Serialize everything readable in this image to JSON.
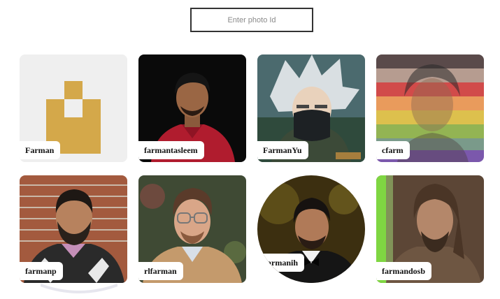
{
  "search": {
    "placeholder": "Enter photo Id",
    "value": ""
  },
  "photos": [
    {
      "username": "Farman",
      "avatar": "identicon-avatar"
    },
    {
      "username": "farmantasleem",
      "avatar": "man-red-shirt-photo"
    },
    {
      "username": "FarmanYu",
      "avatar": "anime-character-avatar"
    },
    {
      "username": "cfarm",
      "avatar": "rainbow-flag-portrait"
    },
    {
      "username": "farmanp",
      "avatar": "bearded-man-brick-wall-photo"
    },
    {
      "username": "rlfarman",
      "avatar": "man-glasses-photo"
    },
    {
      "username": "farmanih",
      "avatar": "man-bowtie-photo"
    },
    {
      "username": "farmandosb",
      "avatar": "jedi-man-photo"
    }
  ]
}
